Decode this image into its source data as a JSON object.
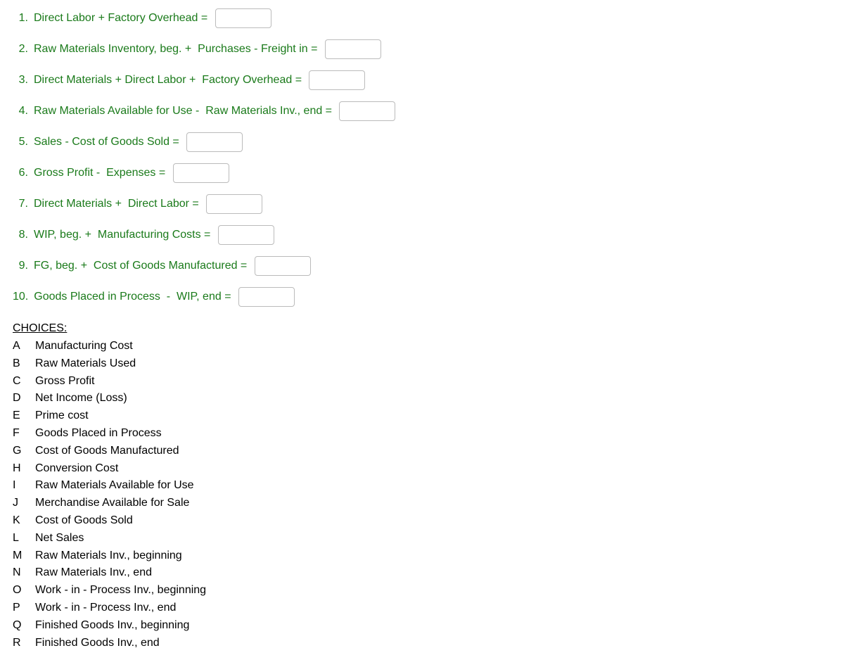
{
  "questions": [
    {
      "num": "1.",
      "text": "Direct Labor + Factory Overhead = "
    },
    {
      "num": "2.",
      "text": "Raw Materials Inventory, beg. +  Purchases - Freight in = "
    },
    {
      "num": "3.",
      "text": "Direct Materials + Direct Labor +  Factory Overhead = "
    },
    {
      "num": "4.",
      "text": "Raw Materials Available for Use -  Raw Materials Inv., end = "
    },
    {
      "num": "5.",
      "text": "Sales - Cost of Goods Sold = "
    },
    {
      "num": "6.",
      "text": "Gross Profit -  Expenses = "
    },
    {
      "num": "7.",
      "text": "Direct Materials +  Direct Labor = "
    },
    {
      "num": "8.",
      "text": "WIP, beg. +  Manufacturing Costs = "
    },
    {
      "num": "9.",
      "text": "FG, beg. +  Cost of Goods Manufactured = "
    },
    {
      "num": "10.",
      "text": "Goods Placed in Process  -  WIP, end = "
    }
  ],
  "choices_header": "CHOICES:",
  "choices": [
    {
      "letter": "A",
      "label": "Manufacturing Cost"
    },
    {
      "letter": "B",
      "label": "Raw Materials Used"
    },
    {
      "letter": "C",
      "label": "Gross Profit"
    },
    {
      "letter": "D",
      "label": "Net Income (Loss)"
    },
    {
      "letter": "E",
      "label": "Prime cost"
    },
    {
      "letter": "F",
      "label": "Goods Placed in Process"
    },
    {
      "letter": "G",
      "label": "Cost of Goods Manufactured"
    },
    {
      "letter": "H",
      "label": "Conversion Cost"
    },
    {
      "letter": "I",
      "label": "Raw Materials Available for Use"
    },
    {
      "letter": "J",
      "label": "Merchandise Available for Sale"
    },
    {
      "letter": "K",
      "label": "Cost of Goods Sold"
    },
    {
      "letter": "L",
      "label": "Net Sales"
    },
    {
      "letter": "M",
      "label": "Raw Materials Inv., beginning"
    },
    {
      "letter": "N",
      "label": "Raw Materials Inv., end"
    },
    {
      "letter": "O",
      "label": "Work - in - Process Inv., beginning"
    },
    {
      "letter": "P",
      "label": "Work - in - Process Inv., end"
    },
    {
      "letter": "Q",
      "label": "Finished Goods Inv., beginning"
    },
    {
      "letter": "R",
      "label": "Finished Goods Inv., end"
    }
  ]
}
